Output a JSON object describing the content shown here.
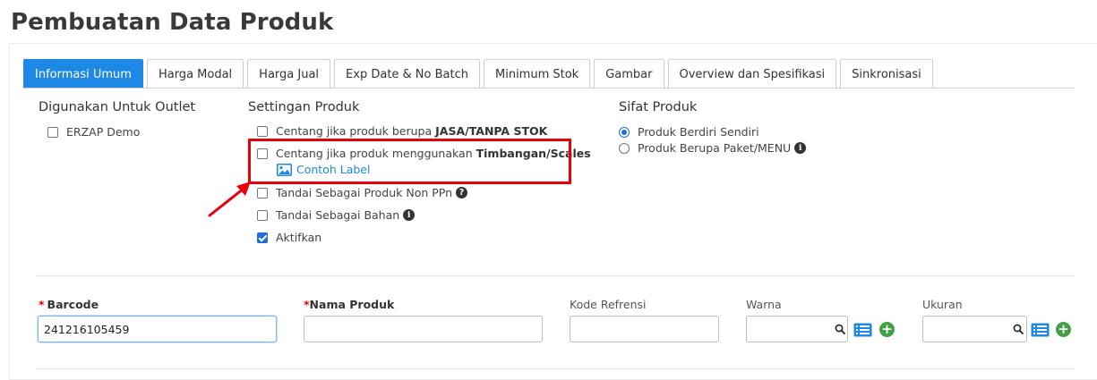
{
  "page": {
    "title": "Pembuatan Data Produk"
  },
  "tabs": [
    {
      "label": "Informasi Umum",
      "active": true
    },
    {
      "label": "Harga Modal"
    },
    {
      "label": "Harga Jual"
    },
    {
      "label": "Exp Date & No Batch"
    },
    {
      "label": "Minimum Stok"
    },
    {
      "label": "Gambar"
    },
    {
      "label": "Overview dan Spesifikasi"
    },
    {
      "label": "Sinkronisasi"
    }
  ],
  "outlet": {
    "title": "Digunakan Untuk Outlet",
    "items": [
      {
        "label": "ERZAP Demo",
        "checked": false
      }
    ]
  },
  "settings": {
    "title": "Settingan Produk",
    "jasa": {
      "prefix": "Centang jika produk berupa",
      "bold": "JASA/TANPA STOK",
      "checked": false
    },
    "timbangan": {
      "prefix": "Centang jika produk menggunakan",
      "bold": "Timbangan/Scales",
      "checked": false
    },
    "contoh_label": "Contoh Label",
    "non_ppn": {
      "label": "Tandai Sebagai Produk Non PPn",
      "checked": false
    },
    "bahan": {
      "label": "Tandai Sebagai Bahan",
      "checked": false
    },
    "aktifkan": {
      "label": "Aktifkan",
      "checked": true
    }
  },
  "sifat": {
    "title": "Sifat Produk",
    "options": [
      {
        "label": "Produk Berdiri Sendiri",
        "selected": true
      },
      {
        "label": "Produk Berupa Paket/MENU",
        "selected": false
      }
    ]
  },
  "fields": {
    "barcode": {
      "star": "*",
      "label": "Barcode",
      "value": "241216105459"
    },
    "nama_produk": {
      "star": "*",
      "label": "Nama Produk",
      "value": ""
    },
    "kode_refrensi": {
      "label": "Kode Refrensi",
      "value": ""
    },
    "warna": {
      "label": "Warna",
      "value": ""
    },
    "ukuran": {
      "label": "Ukuran",
      "value": ""
    }
  },
  "icons": {
    "info_glyph": "i",
    "question_glyph": "?",
    "plus_glyph": "+"
  },
  "colors": {
    "accent": "#1e88e5",
    "highlight": "#e8000b",
    "add_green": "#43a047"
  }
}
